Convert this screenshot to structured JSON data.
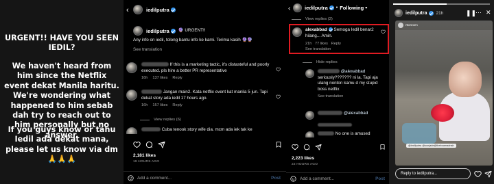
{
  "story": {
    "title": "URGENT!! HAVE YOU SEEN IEDIL?",
    "body": "We haven't heard from him since the Netflix event dekat Manila haritu. We're wondering what happened to him sebab dah try to reach out to him personally but no answer.",
    "ask": "If you guys know or tahu Iedil ada dekat mana, please let us know via dm 🙏🙏🙏"
  },
  "post": {
    "username": "iedilputra",
    "caption_prefix": "🔮 URGENT!!",
    "caption": "Any info on iedil, tolong bantu info ke kami. Terima kasih 🔮🔮",
    "see_translation": "See translation",
    "comments": [
      {
        "text": "If this is a marketing tactic, it's distasteful and poorly executed. pls hire a better PR representative",
        "time": "16h",
        "likes": "137 likes",
        "reply": "Reply"
      },
      {
        "text": "Jangan main2. Kata netflix event kat manila 5 jun. Tapi dekat story ada iedil 17 hours ago.",
        "time": "16h",
        "likes": "157 likes",
        "reply": "Reply"
      },
      {
        "text": "Cuba tenook story wife dia. mcm ada iek tak ke"
      }
    ],
    "view_replies": "View replies (6)",
    "likes_count": "2,181 likes",
    "time_ago": "19 HOURS AGO",
    "add_comment": "Add a comment...",
    "post_label": "Post"
  },
  "thread": {
    "username": "iedilputra",
    "following": "Following",
    "view_replies_top": "View replies (2)",
    "highlighted": {
      "username": "alexabbad",
      "text": "Semoga Iedil benar2 hilang... Amin.",
      "time": "21h",
      "likes": "77 likes",
      "reply": "Reply",
      "see_translation": "See translation"
    },
    "hide_replies": "Hide replies",
    "reply1": {
      "mention": "@alexabbad",
      "text": "seriously??????? ni la. Tapi aja ulang nonton kamu d my stupid boss netflix",
      "see_translation": "See translation"
    },
    "reply2": {
      "mention": "@alexabbad"
    },
    "reply3": {
      "text": "No one is amused"
    },
    "likes_count": "2,223 likes",
    "time_ago": "22 HOURS AGO",
    "add_comment": "Add a comment...",
    "post_label": "Post"
  },
  "story2": {
    "username": "iedilputra",
    "time": "21h",
    "inner_username": "r5orexen",
    "video_label": "@iedilputra @sunjade@theboamadnah",
    "reply_placeholder": "Reply to iedilputra...",
    "progress": 0.55
  },
  "colors": {
    "highlight": "#e11b22",
    "verified": "#3897f0",
    "heart_red": "#ed4956"
  }
}
